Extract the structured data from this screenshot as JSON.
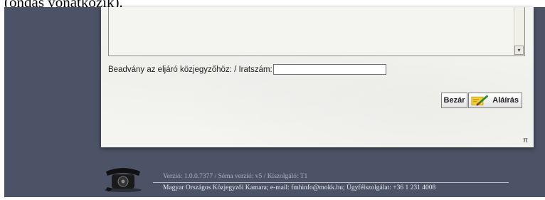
{
  "top_text": "(ondas vonatkozik).",
  "form": {
    "reference_label": "Beadvány az eljáró közjegyzőhöz: / Iratszám:",
    "reference_value": "",
    "scroll_down_glyph": "▾"
  },
  "buttons": {
    "close_label": "Bezár",
    "sign_label": "Aláírás"
  },
  "panel_mark": "π",
  "footer": {
    "version": "Verzió: 1.0.0.7377 / Séma verzió: v5 / Kiszolgáló: T1",
    "contact": "Magyar Országos Közjegyzői Kamara; e-mail: fmhinfo@mokk.hu; Ügyfélszolgálat: +36 1 231 4008"
  },
  "icons": {
    "phone": "telephone-icon",
    "sign": "pen-sign-icon"
  }
}
